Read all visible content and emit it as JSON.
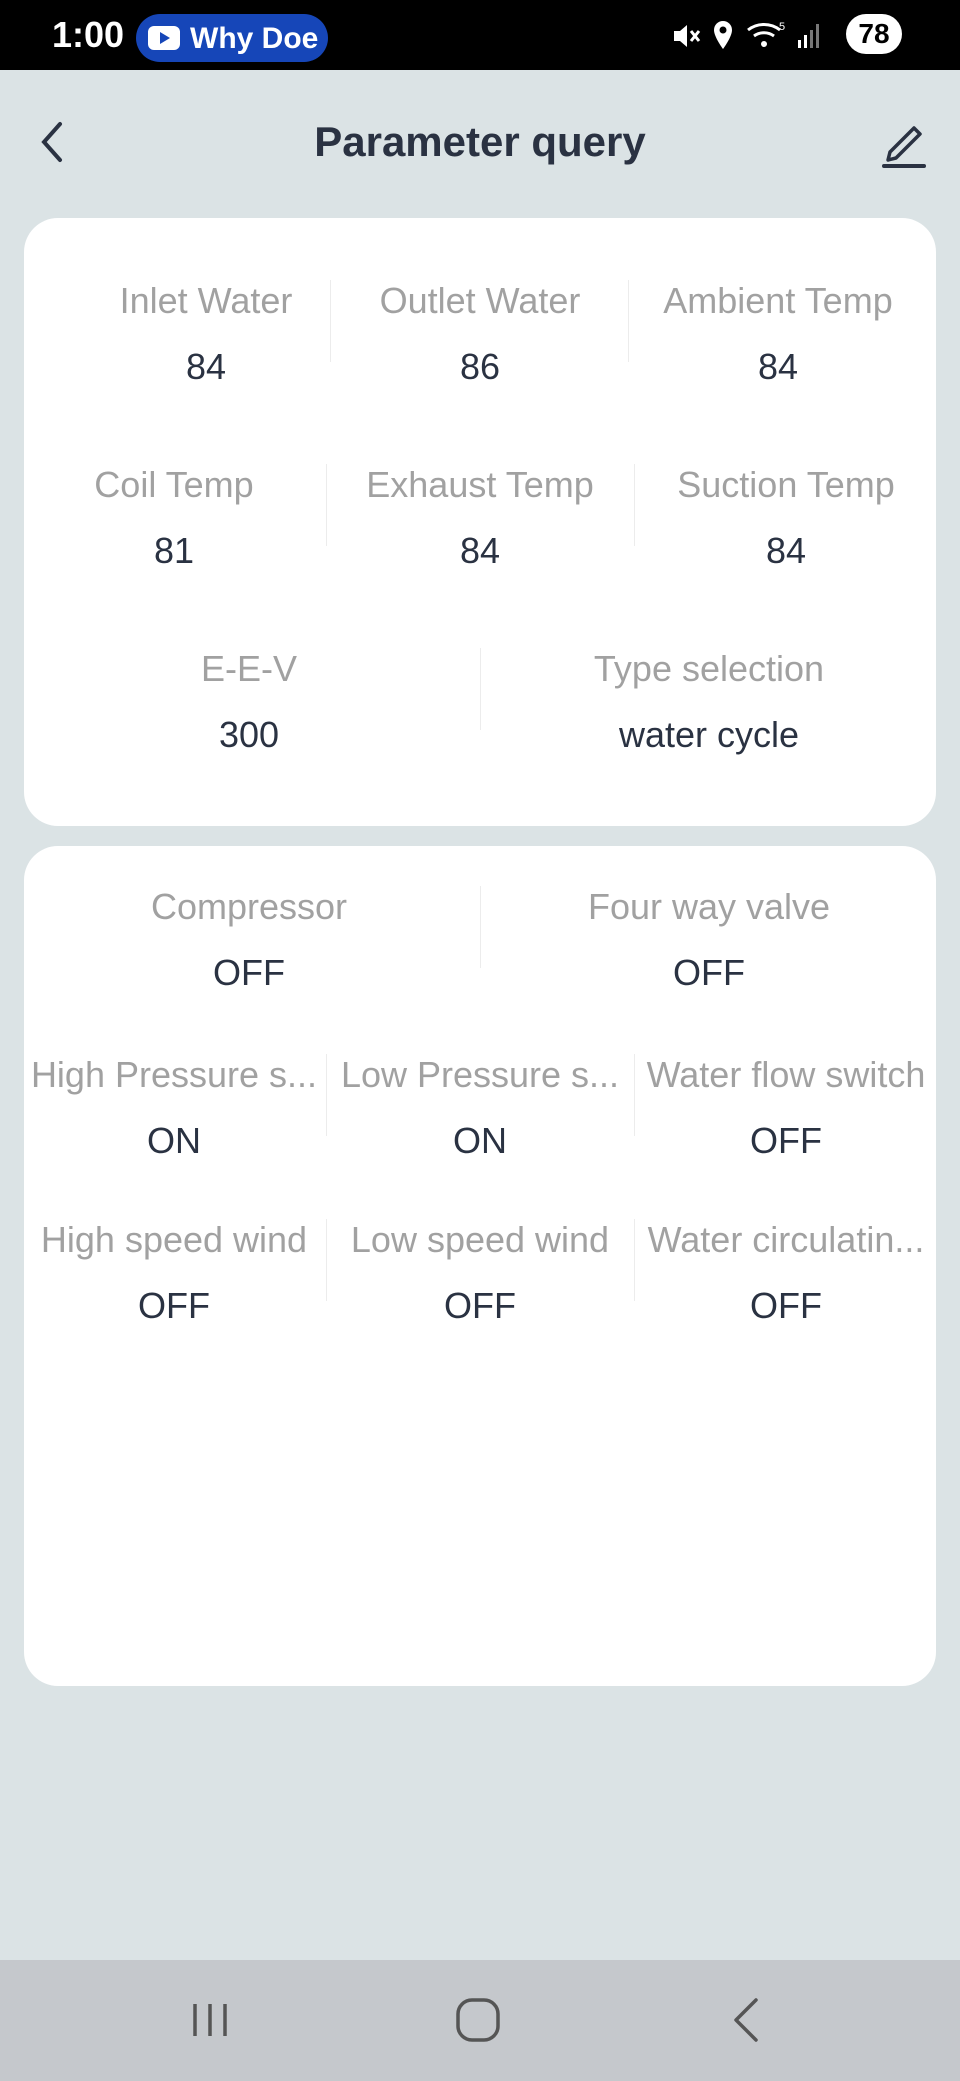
{
  "status_bar": {
    "time": "1:00",
    "notification_text": "Why Doe",
    "battery": "78"
  },
  "header": {
    "title": "Parameter query"
  },
  "temperatures": {
    "inlet_water": {
      "label": "Inlet Water",
      "value": "84"
    },
    "outlet_water": {
      "label": "Outlet Water",
      "value": "86"
    },
    "ambient_temp": {
      "label": "Ambient Temp",
      "value": "84"
    },
    "coil_temp": {
      "label": "Coil Temp",
      "value": "81"
    },
    "exhaust_temp": {
      "label": "Exhaust Temp",
      "value": "84"
    },
    "suction_temp": {
      "label": "Suction Temp",
      "value": "84"
    },
    "eev": {
      "label": "E-E-V",
      "value": "300"
    },
    "type_selection": {
      "label": "Type selection",
      "value": "water cycle"
    }
  },
  "states": {
    "compressor": {
      "label": "Compressor",
      "value": "OFF"
    },
    "four_way_valve": {
      "label": "Four way valve",
      "value": "OFF"
    },
    "high_pressure": {
      "label": "High Pressure s...",
      "value": "ON"
    },
    "low_pressure": {
      "label": "Low Pressure s...",
      "value": "ON"
    },
    "water_flow_switch": {
      "label": "Water flow switch",
      "value": "OFF"
    },
    "high_speed_wind": {
      "label": "High speed wind",
      "value": "OFF"
    },
    "low_speed_wind": {
      "label": "Low speed wind",
      "value": "OFF"
    },
    "water_circulating": {
      "label": "Water circulatin...",
      "value": "OFF"
    }
  },
  "icons": {
    "back": "chevron-left-icon",
    "edit": "pencil-icon",
    "nav_recents": "recents-icon",
    "nav_home": "home-icon",
    "nav_back": "back-icon"
  },
  "colors": {
    "background": "#dbe3e5",
    "card": "#ffffff",
    "label": "#a1a1a1",
    "value": "#2a3242"
  }
}
